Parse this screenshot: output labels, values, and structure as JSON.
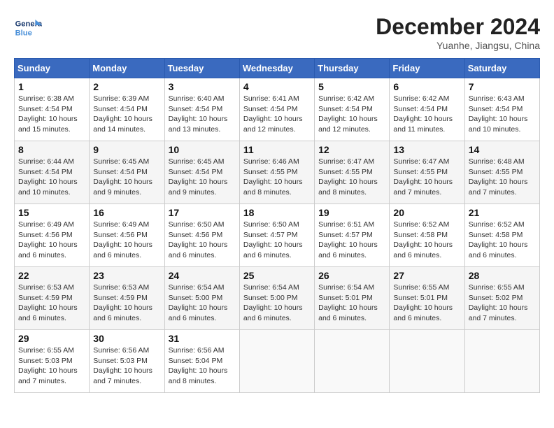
{
  "header": {
    "logo_general": "General",
    "logo_blue": "Blue",
    "month": "December 2024",
    "location": "Yuanhe, Jiangsu, China"
  },
  "days_of_week": [
    "Sunday",
    "Monday",
    "Tuesday",
    "Wednesday",
    "Thursday",
    "Friday",
    "Saturday"
  ],
  "weeks": [
    [
      {
        "day": 1,
        "sunrise": "6:38 AM",
        "sunset": "4:54 PM",
        "daylight": "10 hours and 15 minutes."
      },
      {
        "day": 2,
        "sunrise": "6:39 AM",
        "sunset": "4:54 PM",
        "daylight": "10 hours and 14 minutes."
      },
      {
        "day": 3,
        "sunrise": "6:40 AM",
        "sunset": "4:54 PM",
        "daylight": "10 hours and 13 minutes."
      },
      {
        "day": 4,
        "sunrise": "6:41 AM",
        "sunset": "4:54 PM",
        "daylight": "10 hours and 12 minutes."
      },
      {
        "day": 5,
        "sunrise": "6:42 AM",
        "sunset": "4:54 PM",
        "daylight": "10 hours and 12 minutes."
      },
      {
        "day": 6,
        "sunrise": "6:42 AM",
        "sunset": "4:54 PM",
        "daylight": "10 hours and 11 minutes."
      },
      {
        "day": 7,
        "sunrise": "6:43 AM",
        "sunset": "4:54 PM",
        "daylight": "10 hours and 10 minutes."
      }
    ],
    [
      {
        "day": 8,
        "sunrise": "6:44 AM",
        "sunset": "4:54 PM",
        "daylight": "10 hours and 10 minutes."
      },
      {
        "day": 9,
        "sunrise": "6:45 AM",
        "sunset": "4:54 PM",
        "daylight": "10 hours and 9 minutes."
      },
      {
        "day": 10,
        "sunrise": "6:45 AM",
        "sunset": "4:54 PM",
        "daylight": "10 hours and 9 minutes."
      },
      {
        "day": 11,
        "sunrise": "6:46 AM",
        "sunset": "4:55 PM",
        "daylight": "10 hours and 8 minutes."
      },
      {
        "day": 12,
        "sunrise": "6:47 AM",
        "sunset": "4:55 PM",
        "daylight": "10 hours and 8 minutes."
      },
      {
        "day": 13,
        "sunrise": "6:47 AM",
        "sunset": "4:55 PM",
        "daylight": "10 hours and 7 minutes."
      },
      {
        "day": 14,
        "sunrise": "6:48 AM",
        "sunset": "4:55 PM",
        "daylight": "10 hours and 7 minutes."
      }
    ],
    [
      {
        "day": 15,
        "sunrise": "6:49 AM",
        "sunset": "4:56 PM",
        "daylight": "10 hours and 6 minutes."
      },
      {
        "day": 16,
        "sunrise": "6:49 AM",
        "sunset": "4:56 PM",
        "daylight": "10 hours and 6 minutes."
      },
      {
        "day": 17,
        "sunrise": "6:50 AM",
        "sunset": "4:56 PM",
        "daylight": "10 hours and 6 minutes."
      },
      {
        "day": 18,
        "sunrise": "6:50 AM",
        "sunset": "4:57 PM",
        "daylight": "10 hours and 6 minutes."
      },
      {
        "day": 19,
        "sunrise": "6:51 AM",
        "sunset": "4:57 PM",
        "daylight": "10 hours and 6 minutes."
      },
      {
        "day": 20,
        "sunrise": "6:52 AM",
        "sunset": "4:58 PM",
        "daylight": "10 hours and 6 minutes."
      },
      {
        "day": 21,
        "sunrise": "6:52 AM",
        "sunset": "4:58 PM",
        "daylight": "10 hours and 6 minutes."
      }
    ],
    [
      {
        "day": 22,
        "sunrise": "6:53 AM",
        "sunset": "4:59 PM",
        "daylight": "10 hours and 6 minutes."
      },
      {
        "day": 23,
        "sunrise": "6:53 AM",
        "sunset": "4:59 PM",
        "daylight": "10 hours and 6 minutes."
      },
      {
        "day": 24,
        "sunrise": "6:54 AM",
        "sunset": "5:00 PM",
        "daylight": "10 hours and 6 minutes."
      },
      {
        "day": 25,
        "sunrise": "6:54 AM",
        "sunset": "5:00 PM",
        "daylight": "10 hours and 6 minutes."
      },
      {
        "day": 26,
        "sunrise": "6:54 AM",
        "sunset": "5:01 PM",
        "daylight": "10 hours and 6 minutes."
      },
      {
        "day": 27,
        "sunrise": "6:55 AM",
        "sunset": "5:01 PM",
        "daylight": "10 hours and 6 minutes."
      },
      {
        "day": 28,
        "sunrise": "6:55 AM",
        "sunset": "5:02 PM",
        "daylight": "10 hours and 7 minutes."
      }
    ],
    [
      {
        "day": 29,
        "sunrise": "6:55 AM",
        "sunset": "5:03 PM",
        "daylight": "10 hours and 7 minutes."
      },
      {
        "day": 30,
        "sunrise": "6:56 AM",
        "sunset": "5:03 PM",
        "daylight": "10 hours and 7 minutes."
      },
      {
        "day": 31,
        "sunrise": "6:56 AM",
        "sunset": "5:04 PM",
        "daylight": "10 hours and 8 minutes."
      },
      null,
      null,
      null,
      null
    ]
  ]
}
